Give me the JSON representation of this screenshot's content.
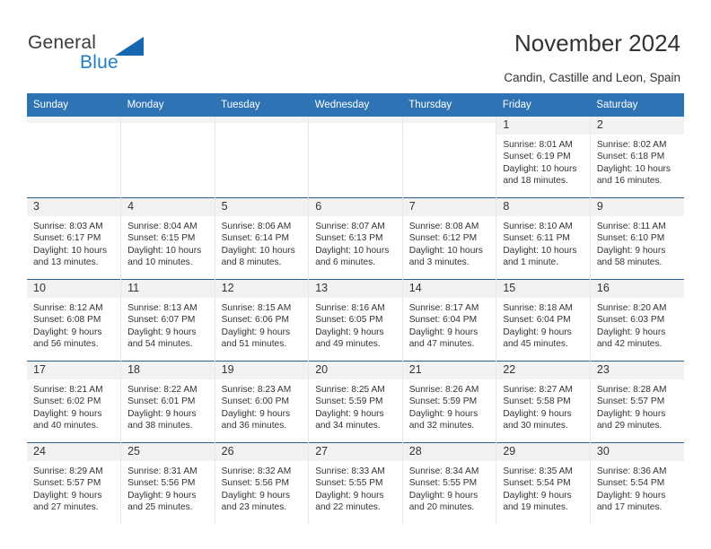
{
  "brand": {
    "name_part1": "General",
    "name_part2": "Blue",
    "logo_icon": "triangle-logo-icon",
    "accent_color": "#1767b0"
  },
  "header": {
    "title": "November 2024",
    "location": "Candin, Castille and Leon, Spain"
  },
  "calendar": {
    "header_bg": "#2e74b5",
    "daynum_bg": "#f2f2f2",
    "row_divider_color": "#2b5f8e",
    "weekdays": [
      "Sunday",
      "Monday",
      "Tuesday",
      "Wednesday",
      "Thursday",
      "Friday",
      "Saturday"
    ],
    "weeks": [
      [
        {
          "day": "",
          "empty": true
        },
        {
          "day": "",
          "empty": true
        },
        {
          "day": "",
          "empty": true
        },
        {
          "day": "",
          "empty": true
        },
        {
          "day": "",
          "empty": true
        },
        {
          "day": "1",
          "sunrise": "Sunrise: 8:01 AM",
          "sunset": "Sunset: 6:19 PM",
          "daylight_line1": "Daylight: 10 hours",
          "daylight_line2": "and 18 minutes."
        },
        {
          "day": "2",
          "sunrise": "Sunrise: 8:02 AM",
          "sunset": "Sunset: 6:18 PM",
          "daylight_line1": "Daylight: 10 hours",
          "daylight_line2": "and 16 minutes."
        }
      ],
      [
        {
          "day": "3",
          "sunrise": "Sunrise: 8:03 AM",
          "sunset": "Sunset: 6:17 PM",
          "daylight_line1": "Daylight: 10 hours",
          "daylight_line2": "and 13 minutes."
        },
        {
          "day": "4",
          "sunrise": "Sunrise: 8:04 AM",
          "sunset": "Sunset: 6:15 PM",
          "daylight_line1": "Daylight: 10 hours",
          "daylight_line2": "and 10 minutes."
        },
        {
          "day": "5",
          "sunrise": "Sunrise: 8:06 AM",
          "sunset": "Sunset: 6:14 PM",
          "daylight_line1": "Daylight: 10 hours",
          "daylight_line2": "and 8 minutes."
        },
        {
          "day": "6",
          "sunrise": "Sunrise: 8:07 AM",
          "sunset": "Sunset: 6:13 PM",
          "daylight_line1": "Daylight: 10 hours",
          "daylight_line2": "and 6 minutes."
        },
        {
          "day": "7",
          "sunrise": "Sunrise: 8:08 AM",
          "sunset": "Sunset: 6:12 PM",
          "daylight_line1": "Daylight: 10 hours",
          "daylight_line2": "and 3 minutes."
        },
        {
          "day": "8",
          "sunrise": "Sunrise: 8:10 AM",
          "sunset": "Sunset: 6:11 PM",
          "daylight_line1": "Daylight: 10 hours",
          "daylight_line2": "and 1 minute."
        },
        {
          "day": "9",
          "sunrise": "Sunrise: 8:11 AM",
          "sunset": "Sunset: 6:10 PM",
          "daylight_line1": "Daylight: 9 hours",
          "daylight_line2": "and 58 minutes."
        }
      ],
      [
        {
          "day": "10",
          "sunrise": "Sunrise: 8:12 AM",
          "sunset": "Sunset: 6:08 PM",
          "daylight_line1": "Daylight: 9 hours",
          "daylight_line2": "and 56 minutes."
        },
        {
          "day": "11",
          "sunrise": "Sunrise: 8:13 AM",
          "sunset": "Sunset: 6:07 PM",
          "daylight_line1": "Daylight: 9 hours",
          "daylight_line2": "and 54 minutes."
        },
        {
          "day": "12",
          "sunrise": "Sunrise: 8:15 AM",
          "sunset": "Sunset: 6:06 PM",
          "daylight_line1": "Daylight: 9 hours",
          "daylight_line2": "and 51 minutes."
        },
        {
          "day": "13",
          "sunrise": "Sunrise: 8:16 AM",
          "sunset": "Sunset: 6:05 PM",
          "daylight_line1": "Daylight: 9 hours",
          "daylight_line2": "and 49 minutes."
        },
        {
          "day": "14",
          "sunrise": "Sunrise: 8:17 AM",
          "sunset": "Sunset: 6:04 PM",
          "daylight_line1": "Daylight: 9 hours",
          "daylight_line2": "and 47 minutes."
        },
        {
          "day": "15",
          "sunrise": "Sunrise: 8:18 AM",
          "sunset": "Sunset: 6:04 PM",
          "daylight_line1": "Daylight: 9 hours",
          "daylight_line2": "and 45 minutes."
        },
        {
          "day": "16",
          "sunrise": "Sunrise: 8:20 AM",
          "sunset": "Sunset: 6:03 PM",
          "daylight_line1": "Daylight: 9 hours",
          "daylight_line2": "and 42 minutes."
        }
      ],
      [
        {
          "day": "17",
          "sunrise": "Sunrise: 8:21 AM",
          "sunset": "Sunset: 6:02 PM",
          "daylight_line1": "Daylight: 9 hours",
          "daylight_line2": "and 40 minutes."
        },
        {
          "day": "18",
          "sunrise": "Sunrise: 8:22 AM",
          "sunset": "Sunset: 6:01 PM",
          "daylight_line1": "Daylight: 9 hours",
          "daylight_line2": "and 38 minutes."
        },
        {
          "day": "19",
          "sunrise": "Sunrise: 8:23 AM",
          "sunset": "Sunset: 6:00 PM",
          "daylight_line1": "Daylight: 9 hours",
          "daylight_line2": "and 36 minutes."
        },
        {
          "day": "20",
          "sunrise": "Sunrise: 8:25 AM",
          "sunset": "Sunset: 5:59 PM",
          "daylight_line1": "Daylight: 9 hours",
          "daylight_line2": "and 34 minutes."
        },
        {
          "day": "21",
          "sunrise": "Sunrise: 8:26 AM",
          "sunset": "Sunset: 5:59 PM",
          "daylight_line1": "Daylight: 9 hours",
          "daylight_line2": "and 32 minutes."
        },
        {
          "day": "22",
          "sunrise": "Sunrise: 8:27 AM",
          "sunset": "Sunset: 5:58 PM",
          "daylight_line1": "Daylight: 9 hours",
          "daylight_line2": "and 30 minutes."
        },
        {
          "day": "23",
          "sunrise": "Sunrise: 8:28 AM",
          "sunset": "Sunset: 5:57 PM",
          "daylight_line1": "Daylight: 9 hours",
          "daylight_line2": "and 29 minutes."
        }
      ],
      [
        {
          "day": "24",
          "sunrise": "Sunrise: 8:29 AM",
          "sunset": "Sunset: 5:57 PM",
          "daylight_line1": "Daylight: 9 hours",
          "daylight_line2": "and 27 minutes."
        },
        {
          "day": "25",
          "sunrise": "Sunrise: 8:31 AM",
          "sunset": "Sunset: 5:56 PM",
          "daylight_line1": "Daylight: 9 hours",
          "daylight_line2": "and 25 minutes."
        },
        {
          "day": "26",
          "sunrise": "Sunrise: 8:32 AM",
          "sunset": "Sunset: 5:56 PM",
          "daylight_line1": "Daylight: 9 hours",
          "daylight_line2": "and 23 minutes."
        },
        {
          "day": "27",
          "sunrise": "Sunrise: 8:33 AM",
          "sunset": "Sunset: 5:55 PM",
          "daylight_line1": "Daylight: 9 hours",
          "daylight_line2": "and 22 minutes."
        },
        {
          "day": "28",
          "sunrise": "Sunrise: 8:34 AM",
          "sunset": "Sunset: 5:55 PM",
          "daylight_line1": "Daylight: 9 hours",
          "daylight_line2": "and 20 minutes."
        },
        {
          "day": "29",
          "sunrise": "Sunrise: 8:35 AM",
          "sunset": "Sunset: 5:54 PM",
          "daylight_line1": "Daylight: 9 hours",
          "daylight_line2": "and 19 minutes."
        },
        {
          "day": "30",
          "sunrise": "Sunrise: 8:36 AM",
          "sunset": "Sunset: 5:54 PM",
          "daylight_line1": "Daylight: 9 hours",
          "daylight_line2": "and 17 minutes."
        }
      ]
    ]
  }
}
